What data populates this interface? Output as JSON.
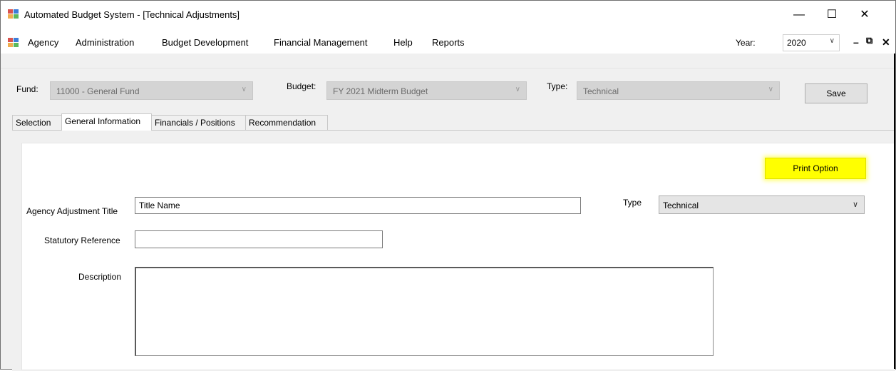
{
  "window": {
    "title": "Automated Budget System - [Technical Adjustments]",
    "controls": {
      "minimize": "—",
      "maximize": "☐",
      "close": "✕"
    }
  },
  "menu": {
    "items": [
      "Agency",
      "Administration",
      "Budget Development",
      "Financial Management",
      "Help",
      "Reports"
    ],
    "year_label": "Year:",
    "year_value": "2020",
    "mdi_minimize": "–",
    "mdi_restore": "🗗",
    "mdi_close": "✕"
  },
  "filters": {
    "fund_label": "Fund:",
    "fund_value": "11000 - General Fund",
    "budget_label": "Budget:",
    "budget_value": "FY 2021 Midterm Budget",
    "type_label": "Type:",
    "type_value": "Technical",
    "save_label": "Save"
  },
  "tabs": [
    "Selection",
    "General Information",
    "Financials / Positions",
    "Recommendation"
  ],
  "active_tab": "General Information",
  "form": {
    "print_option_label": "Print Option",
    "print_option_highlight": "#ffff00",
    "title_label": "Agency Adjustment Title",
    "title_value": "Title Name",
    "type_label": "Type",
    "type_value": "Technical",
    "statutory_label": "Statutory Reference",
    "statutory_value": "",
    "description_label": "Description",
    "description_value": ""
  },
  "icons": {
    "app": "app-window-icon",
    "dropdown": "chevron-down-icon"
  }
}
